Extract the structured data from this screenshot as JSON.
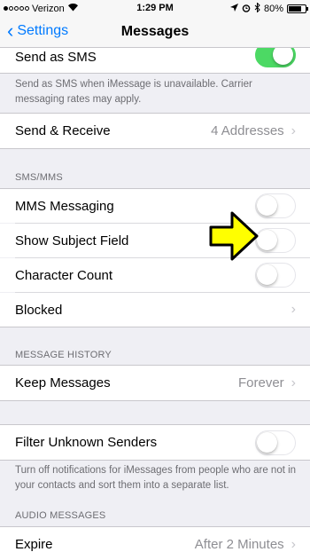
{
  "status": {
    "carrier": "Verizon",
    "time": "1:29 PM",
    "battery": "80%",
    "battery_level": 0.8
  },
  "nav": {
    "back_label": "Settings",
    "title": "Messages"
  },
  "send_as_sms": {
    "label": "Send as SMS",
    "on": true,
    "footer": "Send as SMS when iMessage is unavailable. Carrier messaging rates may apply."
  },
  "send_receive": {
    "label": "Send & Receive",
    "detail": "4 Addresses"
  },
  "sms_mms": {
    "header": "SMS/MMS",
    "mms": {
      "label": "MMS Messaging",
      "on": false
    },
    "subject": {
      "label": "Show Subject Field",
      "on": false
    },
    "char_count": {
      "label": "Character Count",
      "on": false
    },
    "blocked": {
      "label": "Blocked"
    }
  },
  "history": {
    "header": "MESSAGE HISTORY",
    "keep": {
      "label": "Keep Messages",
      "detail": "Forever"
    }
  },
  "filter": {
    "label": "Filter Unknown Senders",
    "on": false,
    "footer": "Turn off notifications for iMessages from people who are not in your contacts and sort them into a separate list."
  },
  "audio": {
    "header": "AUDIO MESSAGES",
    "expire": {
      "label": "Expire",
      "detail": "After 2 Minutes"
    }
  },
  "colors": {
    "accent": "#007aff",
    "toggle_on": "#4cd964",
    "arrow": "#ffff00"
  },
  "icons": {
    "back": "chevron-left-icon",
    "arrow": "yellow-arrow-icon"
  }
}
